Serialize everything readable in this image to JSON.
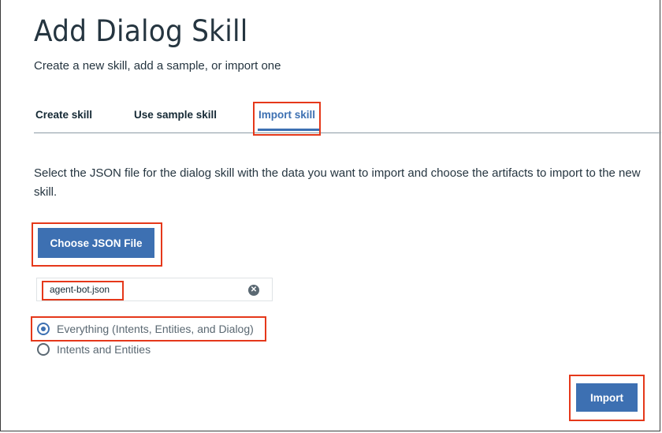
{
  "page": {
    "title": "Add Dialog Skill",
    "subtitle": "Create a new skill, add a sample, or import one"
  },
  "tabs": [
    {
      "label": "Create skill",
      "active": false
    },
    {
      "label": "Use sample skill",
      "active": false
    },
    {
      "label": "Import skill",
      "active": true
    }
  ],
  "import": {
    "description": "Select the JSON file for the dialog skill with the data you want to import and choose the artifacts to import to the new skill.",
    "choose_button": "Choose JSON File",
    "file_name": "agent-bot.json",
    "options": [
      {
        "label": "Everything (Intents, Entities, and Dialog)",
        "selected": true
      },
      {
        "label": "Intents and Entities",
        "selected": false
      }
    ],
    "import_button": "Import"
  },
  "colors": {
    "accent": "#3d70b2",
    "highlight": "#e5381a"
  }
}
